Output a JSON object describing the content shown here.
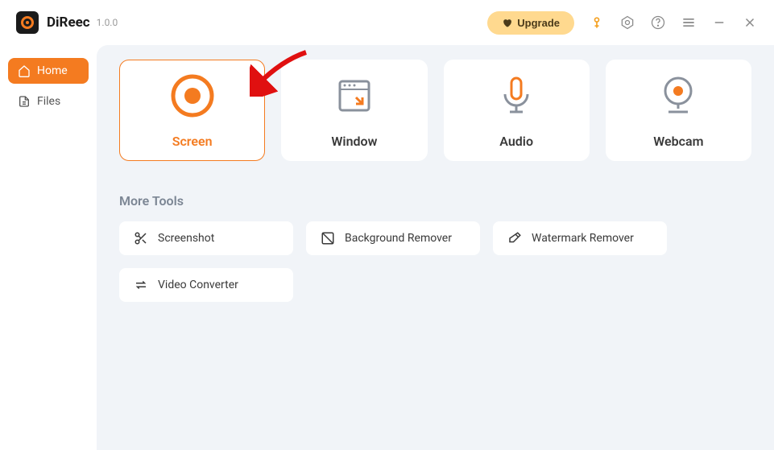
{
  "app": {
    "name": "DiReec",
    "version": "1.0.0"
  },
  "titlebar": {
    "upgrade_label": "Upgrade"
  },
  "sidebar": {
    "items": [
      {
        "label": "Home",
        "active": true
      },
      {
        "label": "Files",
        "active": false
      }
    ]
  },
  "cards": [
    {
      "label": "Screen",
      "active": true
    },
    {
      "label": "Window",
      "active": false
    },
    {
      "label": "Audio",
      "active": false
    },
    {
      "label": "Webcam",
      "active": false
    }
  ],
  "more_tools": {
    "title": "More Tools",
    "items": [
      {
        "label": "Screenshot"
      },
      {
        "label": "Background Remover"
      },
      {
        "label": "Watermark Remover"
      },
      {
        "label": "Video Converter"
      }
    ]
  }
}
